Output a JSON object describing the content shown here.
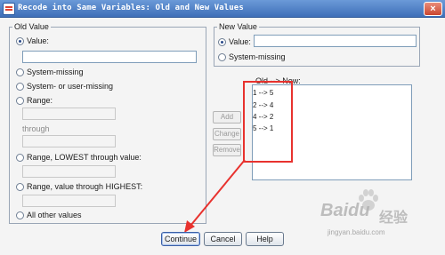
{
  "window": {
    "title": "Recode into Same Variables: Old and New Values",
    "close_glyph": "×"
  },
  "old_value": {
    "legend": "Old Value",
    "value_label": "Value:",
    "system_missing": "System-missing",
    "system_or_user_missing": "System- or user-missing",
    "range": "Range:",
    "through": "through",
    "range_lowest": "Range, LOWEST through value:",
    "range_highest": "Range, value through HIGHEST:",
    "all_other": "All other values"
  },
  "new_value": {
    "legend": "New Value",
    "value_label": "Value:",
    "system_missing": "System-missing"
  },
  "old_new": {
    "label": "Old --> New:",
    "items": [
      "1 --> 5",
      "2 --> 4",
      "4 --> 2",
      "5 --> 1"
    ]
  },
  "side_buttons": {
    "add": "Add",
    "change": "Change",
    "remove": "Remove"
  },
  "footer": {
    "continue": "Continue",
    "cancel": "Cancel",
    "help": "Help"
  },
  "watermark": {
    "main": "Baidu",
    "cn": "经验",
    "url": "jingyan.baidu.com"
  },
  "colors": {
    "highlight": "#e8322e",
    "titlebar": "#4f7fc4"
  }
}
